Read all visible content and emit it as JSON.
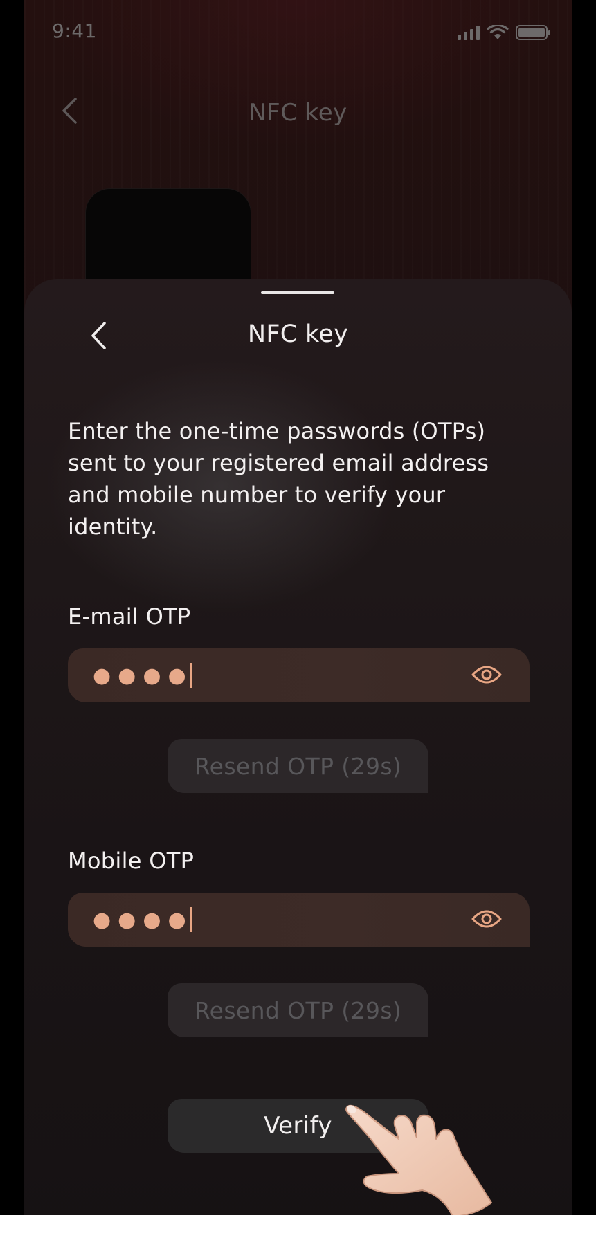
{
  "status_bar": {
    "time": "9:41",
    "icons": [
      "cellular-signal-icon",
      "wifi-icon",
      "battery-icon"
    ]
  },
  "background_screen": {
    "title": "NFC key",
    "back_icon": "chevron-left-icon"
  },
  "sheet": {
    "title": "NFC key",
    "back_icon": "chevron-left-icon",
    "instructions": "Enter the one-time passwords (OTPs) sent to your registered email address and mobile number to verify your identity.",
    "email_otp": {
      "label": "E-mail OTP",
      "value": "●●●●",
      "toggle_icon": "eye-icon"
    },
    "email_resend_label": "Resend OTP (29s)",
    "mobile_otp": {
      "label": "Mobile OTP",
      "value": "●●●●",
      "toggle_icon": "eye-icon"
    },
    "mobile_resend_label": "Resend OTP (29s)",
    "verify_label": "Verify"
  },
  "colors": {
    "accent": "#E8A684",
    "input_bg": "#3B2925",
    "text": "#F3F0F0",
    "disabled_text": "#58575A"
  },
  "overlay_icon": "hand-pointer-icon"
}
